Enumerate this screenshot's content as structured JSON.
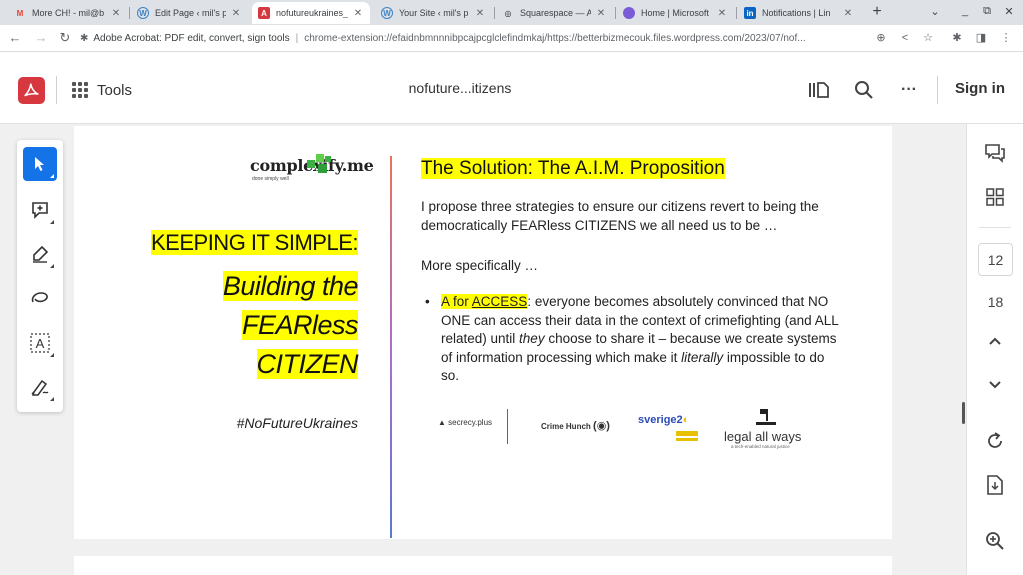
{
  "browser": {
    "tabs": [
      {
        "title": "More CH! - mil@b",
        "favicon": "gmail-icon",
        "color": "#ea4335",
        "active": false
      },
      {
        "title": "Edit Page ‹ mil's p",
        "favicon": "wordpress-icon",
        "color": "#3c83c4",
        "active": false
      },
      {
        "title": "nofutureukraines_",
        "favicon": "acrobat-icon",
        "color": "#d7373f",
        "active": true
      },
      {
        "title": "Your Site ‹ mil's p",
        "favicon": "wordpress-icon",
        "color": "#3c83c4",
        "active": false
      },
      {
        "title": "Squarespace — Ac",
        "favicon": "squarespace-icon",
        "color": "#222222",
        "active": false
      },
      {
        "title": "Home | Microsoft",
        "favicon": "microsoft-icon",
        "color": "#7c5cd6",
        "active": false
      },
      {
        "title": "Notifications | Lin",
        "favicon": "linkedin-icon",
        "color": "#0a66c2",
        "active": false
      }
    ],
    "new_tab": "+",
    "address": {
      "site": "Adobe Acrobat: PDF edit, convert, sign tools",
      "url": "chrome-extension://efaidnbmnnnibpcajpcglclefindmkaj/https://betterbizmecouk.files.wordpress.com/2023/07/nof..."
    }
  },
  "acrobat": {
    "tools_label": "Tools",
    "doc_title": "nofuture...itizens",
    "signin_label": "Sign in",
    "more_label": "···"
  },
  "slide": {
    "logo": {
      "text": "complexify.me",
      "tagline": "done simply well"
    },
    "keep_simple": "KEEPING IT SIMPLE:",
    "big_lines": [
      "Building the",
      "FEARless",
      "CITIZEN"
    ],
    "hashtag": "#NoFutureUkraines",
    "solution_title": "The Solution: The A.I.M. Proposition",
    "intro": "I propose three strategies to ensure our citizens revert to being the democratically FEARless CITIZENS we all need us to be …",
    "more_specifically": "More specifically …",
    "bullet": {
      "label": "A for",
      "keyword": "ACCESS",
      "text_1": ": everyone becomes absolutely convinced that NO ONE can access their data in the context of crimefighting (and ALL related) until ",
      "they": "they",
      "text_2": " choose to share it – because we create systems of information processing which make it ",
      "literally": "literally",
      "text_3": " impossible to do so."
    },
    "partners": {
      "secrecy": "secrecy.plus",
      "crimehunch": "Crime Hunch",
      "sverige": "sverige2",
      "legal": "legal all ways",
      "legal_sub": "a tech-enabled natural justice"
    }
  },
  "pagination": {
    "current": "12",
    "total": "18"
  },
  "colors": {
    "acrobat_red": "#d7373f",
    "active_tool": "#1473e6",
    "highlight": "#ffff00"
  }
}
